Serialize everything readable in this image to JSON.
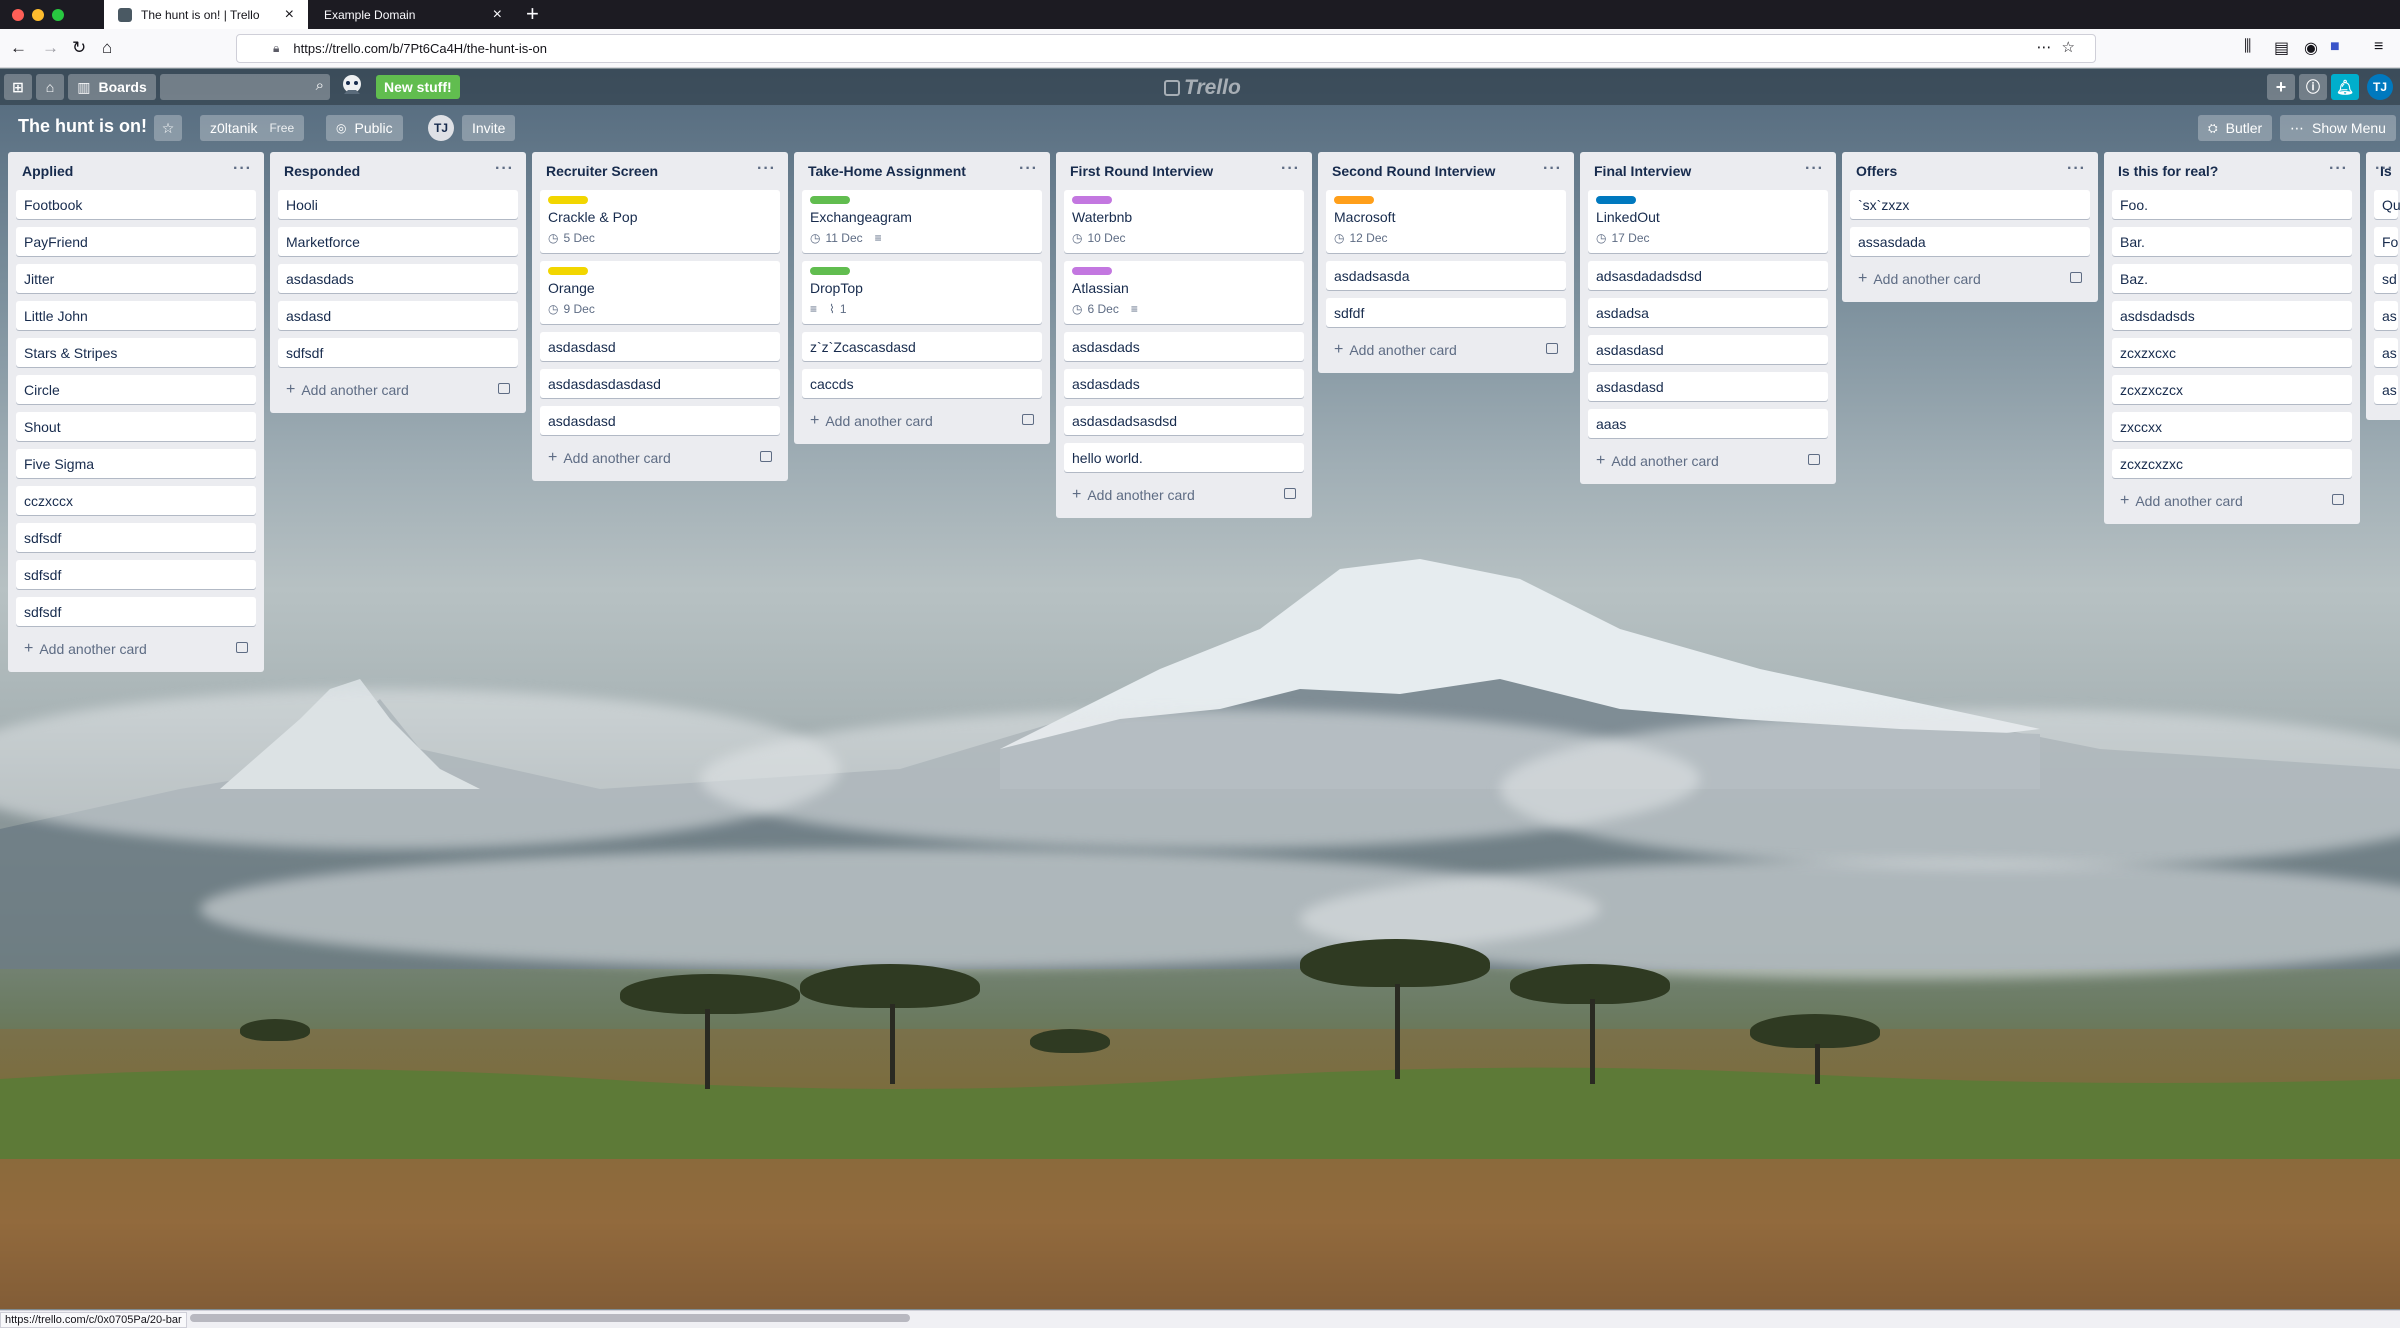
{
  "browser": {
    "tabs": [
      {
        "label": "The hunt is on! | Trello",
        "active": true
      },
      {
        "label": "Example Domain",
        "active": false
      }
    ],
    "url": "https://trello.com/b/7Pt6Ca4H/the-hunt-is-on",
    "status_url": "https://trello.com/c/0x0705Pa/20-bar"
  },
  "header": {
    "boards_label": "Boards",
    "new_stuff_label": "New stuff!",
    "logo_text": "Trello",
    "user_initials": "TJ"
  },
  "board": {
    "title": "The hunt is on!",
    "team": "z0ltanik",
    "team_plan": "Free",
    "visibility": "Public",
    "member_initials": "TJ",
    "invite_label": "Invite",
    "butler_label": "Butler",
    "show_menu_label": "Show Menu"
  },
  "add_card_label": "Add another card",
  "lists": [
    {
      "title": "Applied",
      "cards": [
        {
          "title": "Footbook"
        },
        {
          "title": "PayFriend"
        },
        {
          "title": "Jitter"
        },
        {
          "title": "Little John"
        },
        {
          "title": "Stars & Stripes"
        },
        {
          "title": "Circle"
        },
        {
          "title": "Shout"
        },
        {
          "title": "Five Sigma"
        },
        {
          "title": "cczxccx"
        },
        {
          "title": "sdfsdf"
        },
        {
          "title": "sdfsdf"
        },
        {
          "title": "sdfsdf"
        }
      ]
    },
    {
      "title": "Responded",
      "cards": [
        {
          "title": "Hooli"
        },
        {
          "title": "Marketforce"
        },
        {
          "title": "asdasdads"
        },
        {
          "title": "asdasd"
        },
        {
          "title": "sdfsdf"
        }
      ]
    },
    {
      "title": "Recruiter Screen",
      "cards": [
        {
          "title": "Crackle & Pop",
          "label_color": "#f2d600",
          "due": "5 Dec"
        },
        {
          "title": "Orange",
          "label_color": "#f2d600",
          "due": "9 Dec"
        },
        {
          "title": "asdasdasd"
        },
        {
          "title": "asdasdasdasdasd"
        },
        {
          "title": "asdasdasd"
        }
      ]
    },
    {
      "title": "Take-Home Assignment",
      "cards": [
        {
          "title": "Exchangeagram",
          "label_color": "#61bd4f",
          "due": "11 Dec",
          "description": true
        },
        {
          "title": "DropTop",
          "label_color": "#61bd4f",
          "description": true,
          "attachments": "1"
        },
        {
          "title": "z`z`Zcascasdasd"
        },
        {
          "title": "caccds"
        }
      ]
    },
    {
      "title": "First Round Interview",
      "cards": [
        {
          "title": "Waterbnb",
          "label_color": "#c377e0",
          "due": "10 Dec"
        },
        {
          "title": "Atlassian",
          "label_color": "#c377e0",
          "due": "6 Dec",
          "description": true
        },
        {
          "title": "asdasdads"
        },
        {
          "title": "asdasdads"
        },
        {
          "title": "asdasdadsasdsd"
        },
        {
          "title": "hello world."
        }
      ]
    },
    {
      "title": "Second Round Interview",
      "cards": [
        {
          "title": "Macrosoft",
          "label_color": "#ff9f1a",
          "due": "12 Dec"
        },
        {
          "title": "asdadsasda"
        },
        {
          "title": "sdfdf"
        }
      ]
    },
    {
      "title": "Final Interview",
      "cards": [
        {
          "title": "LinkedOut",
          "label_color": "#0079bf",
          "due": "17 Dec"
        },
        {
          "title": "adsasdadadsdsd"
        },
        {
          "title": "asdadsa"
        },
        {
          "title": "asdasdasd"
        },
        {
          "title": "asdasdasd"
        },
        {
          "title": "aaas"
        }
      ]
    },
    {
      "title": "Offers",
      "cards": [
        {
          "title": "`sx`zxzx"
        },
        {
          "title": "assasdada"
        }
      ]
    },
    {
      "title": "Is this for real?",
      "cards": [
        {
          "title": "Foo."
        },
        {
          "title": "Bar."
        },
        {
          "title": "Baz."
        },
        {
          "title": "asdsdadsds"
        },
        {
          "title": "zcxzxcxc"
        },
        {
          "title": "zcxzxczcx"
        },
        {
          "title": "zxccxx"
        },
        {
          "title": "zcxzcxzxc"
        }
      ]
    },
    {
      "title": "Is",
      "cards": [
        {
          "title": "Qu"
        },
        {
          "title": "Fo"
        },
        {
          "title": "sd"
        },
        {
          "title": "as"
        },
        {
          "title": "as"
        },
        {
          "title": "as"
        }
      ]
    }
  ]
}
